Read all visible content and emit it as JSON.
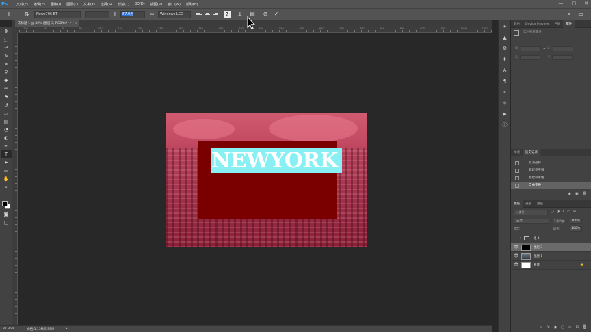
{
  "menubar": {
    "logo": "Ps",
    "items": [
      "文件(F)",
      "编辑(E)",
      "图像(I)",
      "图层(L)",
      "文字(Y)",
      "选择(S)",
      "滤镜(T)",
      "3D(D)",
      "视图(V)",
      "窗口(W)",
      "帮助(H)"
    ],
    "window_controls": [
      "—",
      "□",
      "✕"
    ]
  },
  "options": {
    "font_family": "News706 BT",
    "font_size": "87.9点",
    "antialias": "Windows LCD",
    "antialias_label": "aa"
  },
  "document_tab": {
    "label": "未标题-1 @ 82% (图层 3, RGB/8#) *",
    "close": "×"
  },
  "ruler": {
    "labels": [
      "100",
      "50",
      "0",
      "50",
      "100",
      "150",
      "200",
      "250",
      "300",
      "350",
      "400",
      "450",
      "500",
      "550",
      "600",
      "650",
      "700",
      "750",
      "800",
      "850",
      "900",
      "950",
      "1000",
      "1050"
    ]
  },
  "canvas": {
    "text": "NEWYORK",
    "colors": {
      "sky": "#d05a70",
      "overlay_rect": "#7a0000",
      "text_selection": "#88f0f2",
      "text": "#ffffff"
    }
  },
  "status": {
    "zoom": "81.96%",
    "doc_info": "文档:1.13M/5.55M",
    "arrow": ">"
  },
  "panel_top": {
    "tabs": [
      "颜色",
      "Device Preview",
      "色板",
      "属性"
    ],
    "active_tab": "属性",
    "title": "实时形状属性",
    "fields": {
      "w_label": "W:",
      "h_label": "H:",
      "x_label": "X:",
      "y_label": "Y:",
      "link": "∞"
    }
  },
  "panel_history": {
    "tabs": [
      "样式",
      "历史记录"
    ],
    "active_tab": "历史记录",
    "items": [
      {
        "label": "取消选择",
        "selected": false
      },
      {
        "label": "新建参考线",
        "selected": false
      },
      {
        "label": "新建参考线",
        "selected": false
      },
      {
        "label": "自由变换",
        "selected": true
      }
    ]
  },
  "panel_layers": {
    "tabs": [
      "图层",
      "通道",
      "路径"
    ],
    "active_tab": "图层",
    "filter_label": "类型",
    "blend_mode": "正常",
    "opacity_label": "不透明度:",
    "opacity_value": "100%",
    "lock_label": "锁定:",
    "fill_label": "填充:",
    "fill_value": "100%",
    "layers": [
      {
        "name": "组 1",
        "type": "group",
        "visible": false,
        "selected": false
      },
      {
        "name": "图层 3",
        "type": "black",
        "visible": true,
        "selected": true
      },
      {
        "name": "图层 1",
        "type": "photo",
        "visible": true,
        "selected": false
      },
      {
        "name": "背景",
        "type": "white",
        "visible": true,
        "selected": false,
        "locked": true
      }
    ],
    "footer_icons": [
      "∞",
      "fx",
      "◑",
      "▢",
      "▭",
      "⊞",
      "🗑"
    ]
  }
}
